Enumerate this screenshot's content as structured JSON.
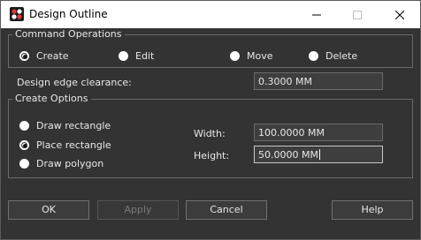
{
  "window": {
    "title": "Design Outline"
  },
  "command_operations": {
    "title": "Command Operations",
    "options": [
      {
        "label": "Create",
        "checked": true
      },
      {
        "label": "Edit",
        "checked": false
      },
      {
        "label": "Move",
        "checked": false
      },
      {
        "label": "Delete",
        "checked": false
      }
    ]
  },
  "clearance": {
    "label": "Design edge clearance:",
    "value": "0.3000 MM"
  },
  "create_options": {
    "title": "Create Options",
    "options": [
      {
        "label": "Draw rectangle",
        "checked": false
      },
      {
        "label": "Place rectangle",
        "checked": true
      },
      {
        "label": "Draw polygon",
        "checked": false
      }
    ],
    "width_label": "Width:",
    "width_value": "100.0000 MM",
    "height_label": "Height:",
    "height_value": "50.0000 MM"
  },
  "buttons": {
    "ok": "OK",
    "apply": "Apply",
    "cancel": "Cancel",
    "help": "Help"
  }
}
